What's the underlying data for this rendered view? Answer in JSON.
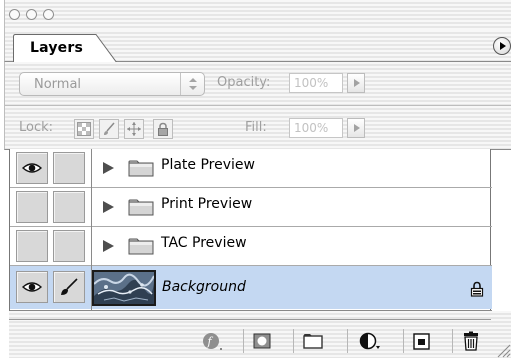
{
  "panel": {
    "tab_label": "Layers",
    "blend_mode": "Normal",
    "opacity_label": "Opacity:",
    "opacity_value": "100%",
    "lock_label": "Lock:",
    "fill_label": "Fill:",
    "fill_value": "100%"
  },
  "layers": [
    {
      "name": "Plate Preview",
      "type": "group",
      "visible": true,
      "collapsed": true
    },
    {
      "name": "Print Preview",
      "type": "group",
      "visible": false,
      "collapsed": true
    },
    {
      "name": "TAC Preview",
      "type": "group",
      "visible": false,
      "collapsed": true
    },
    {
      "name": "Background",
      "type": "layer",
      "visible": true,
      "selected": true,
      "locked": true
    }
  ],
  "colors": {
    "selection": "#c4d8f2",
    "disabled_text": "#9f9f9f"
  },
  "icons": {
    "lock_transparency": "checker-icon",
    "lock_image": "brush-icon",
    "lock_position": "move-icon",
    "lock_all": "padlock-icon",
    "toolbar": [
      "layer-style-icon",
      "layer-mask-icon",
      "new-set-icon",
      "adjustment-layer-icon",
      "new-layer-icon",
      "trash-icon"
    ]
  }
}
